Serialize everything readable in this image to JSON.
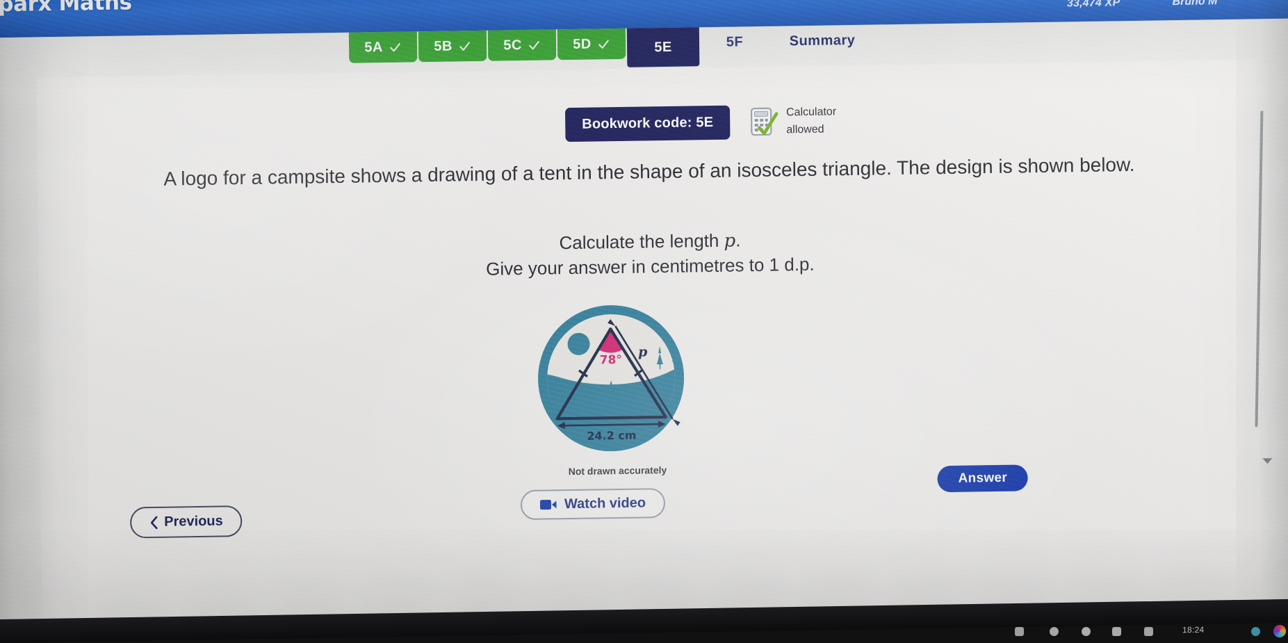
{
  "app": {
    "brand": "Sparx Maths",
    "xp": "33,474 XP",
    "user": "Bruno M"
  },
  "tabs": [
    {
      "label": "5A",
      "state": "done"
    },
    {
      "label": "5B",
      "state": "done"
    },
    {
      "label": "5C",
      "state": "done"
    },
    {
      "label": "5D",
      "state": "done"
    },
    {
      "label": "5E",
      "state": "active"
    },
    {
      "label": "5F",
      "state": "todo"
    },
    {
      "label": "Summary",
      "state": "summary"
    }
  ],
  "question": {
    "bookwork_label": "Bookwork code: 5E",
    "calculator_line1": "Calculator",
    "calculator_line2": "allowed",
    "body": "A logo for a campsite shows a drawing of a tent in the shape of an isosceles triangle. The design is shown below.",
    "prompt_line1_before": "Calculate the length ",
    "prompt_line1_var": "p",
    "prompt_line1_after": ".",
    "prompt_line2": "Give your answer in centimetres to 1 d.p.",
    "not_drawn": "Not drawn accurately"
  },
  "figure": {
    "angle_label": "78°",
    "side_label": "p",
    "base_label": "24.2 cm",
    "logo_color": "#2d7c9b",
    "angle_color": "#d6206e",
    "line_color": "#14203f"
  },
  "controls": {
    "previous": "Previous",
    "watch_video": "Watch video",
    "answer": "Answer"
  },
  "os": {
    "clock": "18:24"
  },
  "colors": {
    "header_blue": "#2d6fd6",
    "tab_green": "#3aa535",
    "navy": "#20225c",
    "answer_blue": "#1d3fb0"
  }
}
